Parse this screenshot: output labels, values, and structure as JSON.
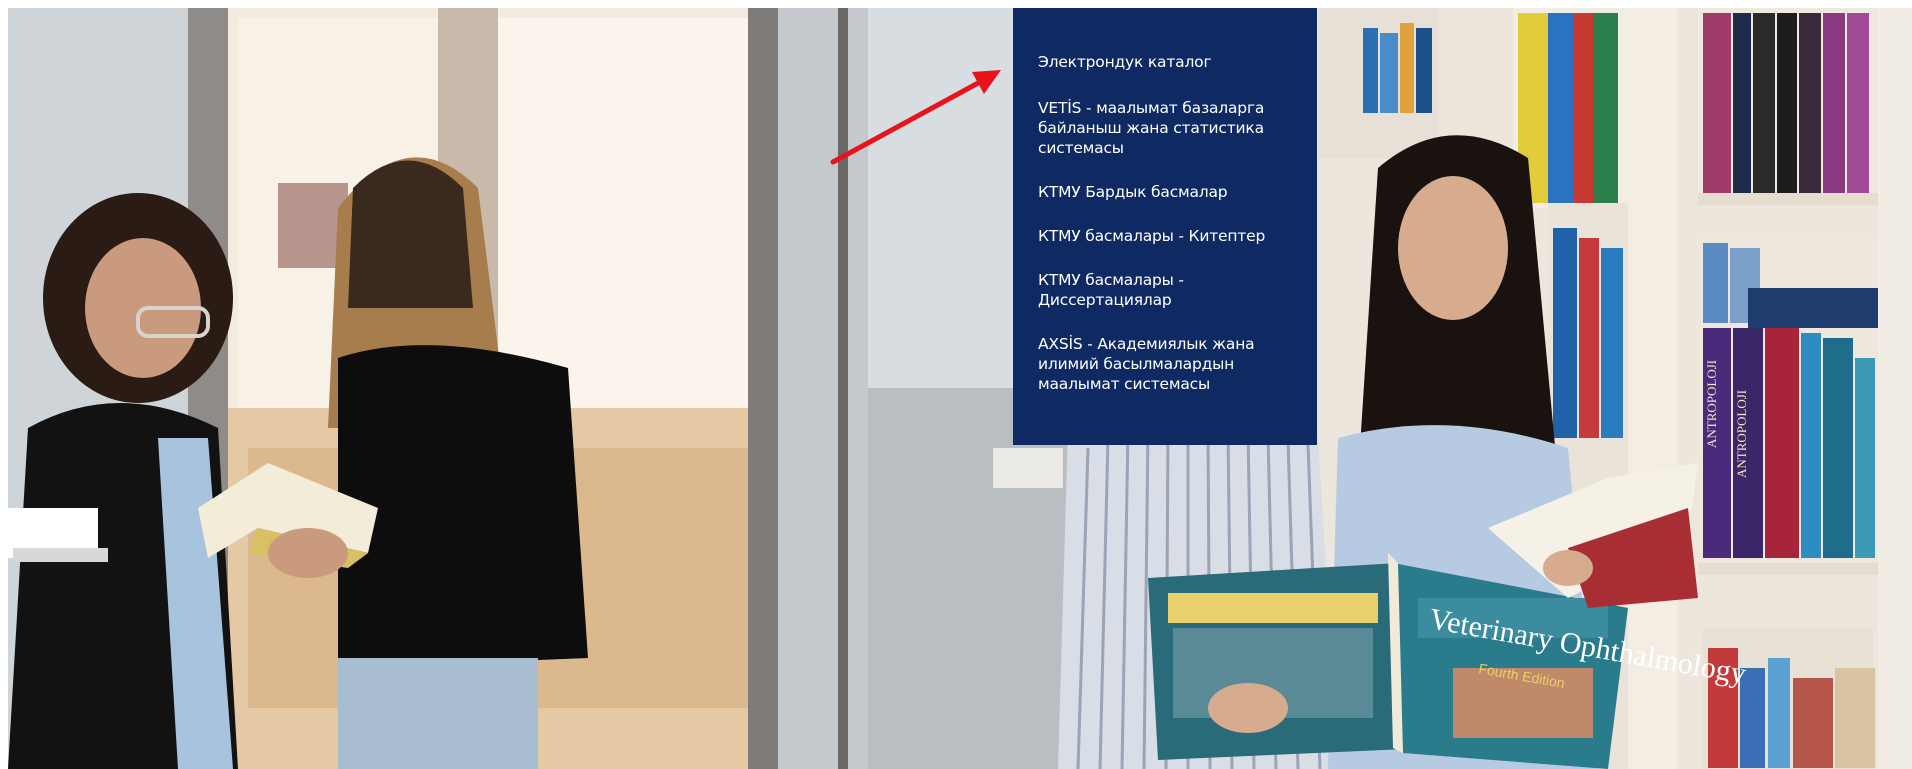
{
  "dropdown_menu": {
    "items": [
      {
        "label": "Электрондук каталог"
      },
      {
        "label": "VETİS - маалымат базаларга байланыш жана статистика системасы"
      },
      {
        "label": "КТМУ Бардык басмалар"
      },
      {
        "label": "КТМУ басмалары - Китептер"
      },
      {
        "label": "КТМУ басмалары - Диссертациялар"
      },
      {
        "label": "AXSİS - Академиялык жана илимий басылмалардын маалымат системасы"
      }
    ]
  },
  "hero_image": {
    "book_cover_title": "Veterinary Ophthalmology",
    "book_cover_edition": "Fourth Edition",
    "shelf_book_spine": "ANTROPOLOJI"
  },
  "colors": {
    "menu_background": "#0f2a62",
    "menu_text": "#ffffff",
    "arrow": "#e8141b"
  }
}
